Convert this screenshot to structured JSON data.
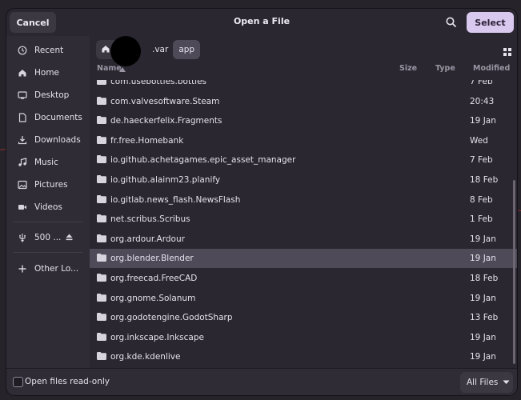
{
  "window": {
    "title": "Open a File"
  },
  "header": {
    "cancel_label": "Cancel",
    "select_label": "Select"
  },
  "sidebar": {
    "items": [
      {
        "label": "Recent",
        "icon": "clock-icon"
      },
      {
        "label": "Home",
        "icon": "home-icon"
      },
      {
        "label": "Desktop",
        "icon": "desktop-icon"
      },
      {
        "label": "Documents",
        "icon": "documents-icon"
      },
      {
        "label": "Downloads",
        "icon": "download-icon"
      },
      {
        "label": "Music",
        "icon": "music-icon"
      },
      {
        "label": "Pictures",
        "icon": "pictures-icon"
      },
      {
        "label": "Videos",
        "icon": "videos-icon"
      }
    ],
    "drive": {
      "label": "500 ...",
      "icon": "usb-icon"
    },
    "other": {
      "label": "Other Lo...",
      "icon": "plus-icon"
    }
  },
  "pathbar": {
    "crumbs": [
      ".var",
      "app"
    ]
  },
  "columns": {
    "name": "Name",
    "size": "Size",
    "type": "Type",
    "modified": "Modified"
  },
  "files": [
    {
      "name": "com.usebottles.bottles",
      "modified": "7 Feb"
    },
    {
      "name": "com.valvesoftware.Steam",
      "modified": "20:43"
    },
    {
      "name": "de.haeckerfelix.Fragments",
      "modified": "19 Jan"
    },
    {
      "name": "fr.free.Homebank",
      "modified": "Wed"
    },
    {
      "name": "io.github.achetagames.epic_asset_manager",
      "modified": "7 Feb"
    },
    {
      "name": "io.github.alainm23.planify",
      "modified": "18 Feb"
    },
    {
      "name": "io.gitlab.news_flash.NewsFlash",
      "modified": "8 Feb"
    },
    {
      "name": "net.scribus.Scribus",
      "modified": "1 Feb"
    },
    {
      "name": "org.ardour.Ardour",
      "modified": "19 Jan"
    },
    {
      "name": "org.blender.Blender",
      "modified": "19 Jan"
    },
    {
      "name": "org.freecad.FreeCAD",
      "modified": "18 Feb"
    },
    {
      "name": "org.gnome.Solanum",
      "modified": "19 Jan"
    },
    {
      "name": "org.godotengine.GodotSharp",
      "modified": "13 Feb"
    },
    {
      "name": "org.inkscape.Inkscape",
      "modified": "19 Jan"
    },
    {
      "name": "org.kde.kdenlive",
      "modified": "19 Jan"
    }
  ],
  "selected_file": "org.blender.Blender",
  "footer": {
    "readonly_label": "Open files read-only",
    "filter_value": "All Files"
  }
}
